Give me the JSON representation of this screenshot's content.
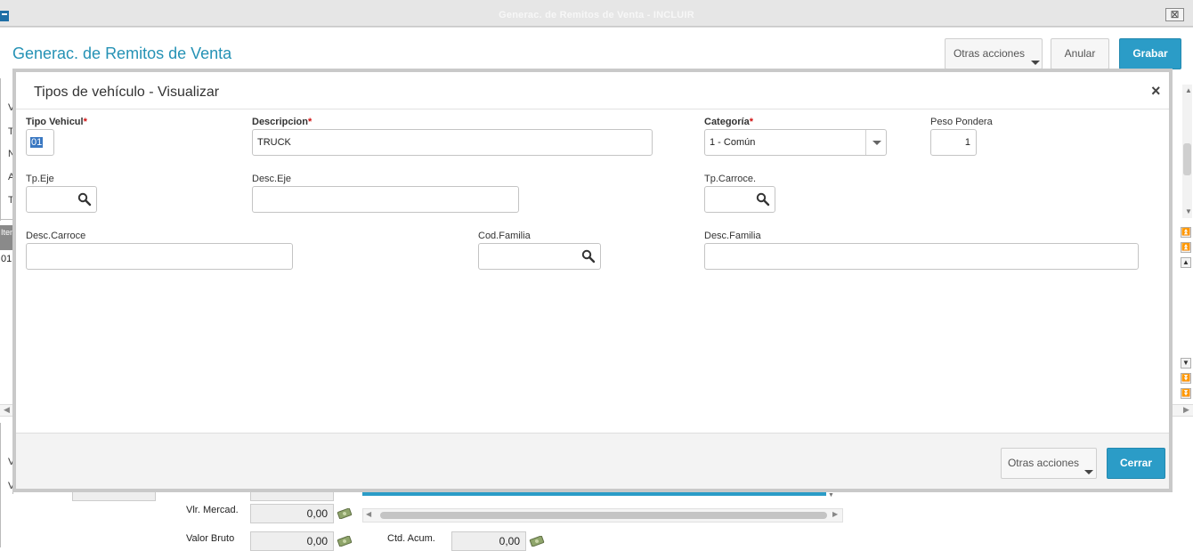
{
  "window": {
    "title": "Generac. de Remitos de Venta - INCLUIR",
    "close_glyph": "⊠"
  },
  "header": {
    "title": "Generac. de Remitos de Venta",
    "buttons": {
      "otras_acciones": "Otras acciones",
      "anular": "Anular",
      "grabar": "Grabar"
    }
  },
  "background": {
    "side_letters": [
      "V",
      "T",
      "N",
      "A",
      "T"
    ],
    "grid": {
      "col_header": "Iten",
      "first_row": "01"
    },
    "lower_letters": [
      "V",
      "V"
    ],
    "totals": [
      {
        "label": "Vlr. Mercad.",
        "value": "0,00"
      },
      {
        "label": "Valor Bruto",
        "value": "0,00"
      },
      {
        "label": "Ctd. Acum.",
        "value": "0,00"
      }
    ]
  },
  "modal": {
    "title": "Tipos de vehículo - Visualizar",
    "close_glyph": "×",
    "fields": {
      "tipo_vehicul": {
        "label": "Tipo Vehicul",
        "required": "*",
        "value": "01"
      },
      "descripcion": {
        "label": "Descripcion",
        "required": "*",
        "value": "TRUCK"
      },
      "categoria": {
        "label": "Categoría",
        "required": "*",
        "value": "1 - Común"
      },
      "peso_pondera": {
        "label": "Peso Pondera",
        "value": "1"
      },
      "tp_eje": {
        "label": "Tp.Eje",
        "value": ""
      },
      "desc_eje": {
        "label": "Desc.Eje",
        "value": ""
      },
      "tp_carroce": {
        "label": "Tp.Carroce.",
        "value": ""
      },
      "desc_carroce": {
        "label": "Desc.Carroce",
        "value": ""
      },
      "cod_familia": {
        "label": "Cod.Familia",
        "value": ""
      },
      "desc_familia": {
        "label": "Desc.Familia",
        "value": ""
      }
    },
    "footer": {
      "otras_acciones": "Otras acciones",
      "cerrar": "Cerrar"
    }
  },
  "colors": {
    "accent": "#2b9cc7",
    "title_blue": "#2592b5",
    "required": "#d01010",
    "modal_border": "#c9c9c9"
  },
  "icons": [
    "app-icon",
    "search-icon",
    "chevron-down-icon",
    "money-icon",
    "close-icon"
  ]
}
